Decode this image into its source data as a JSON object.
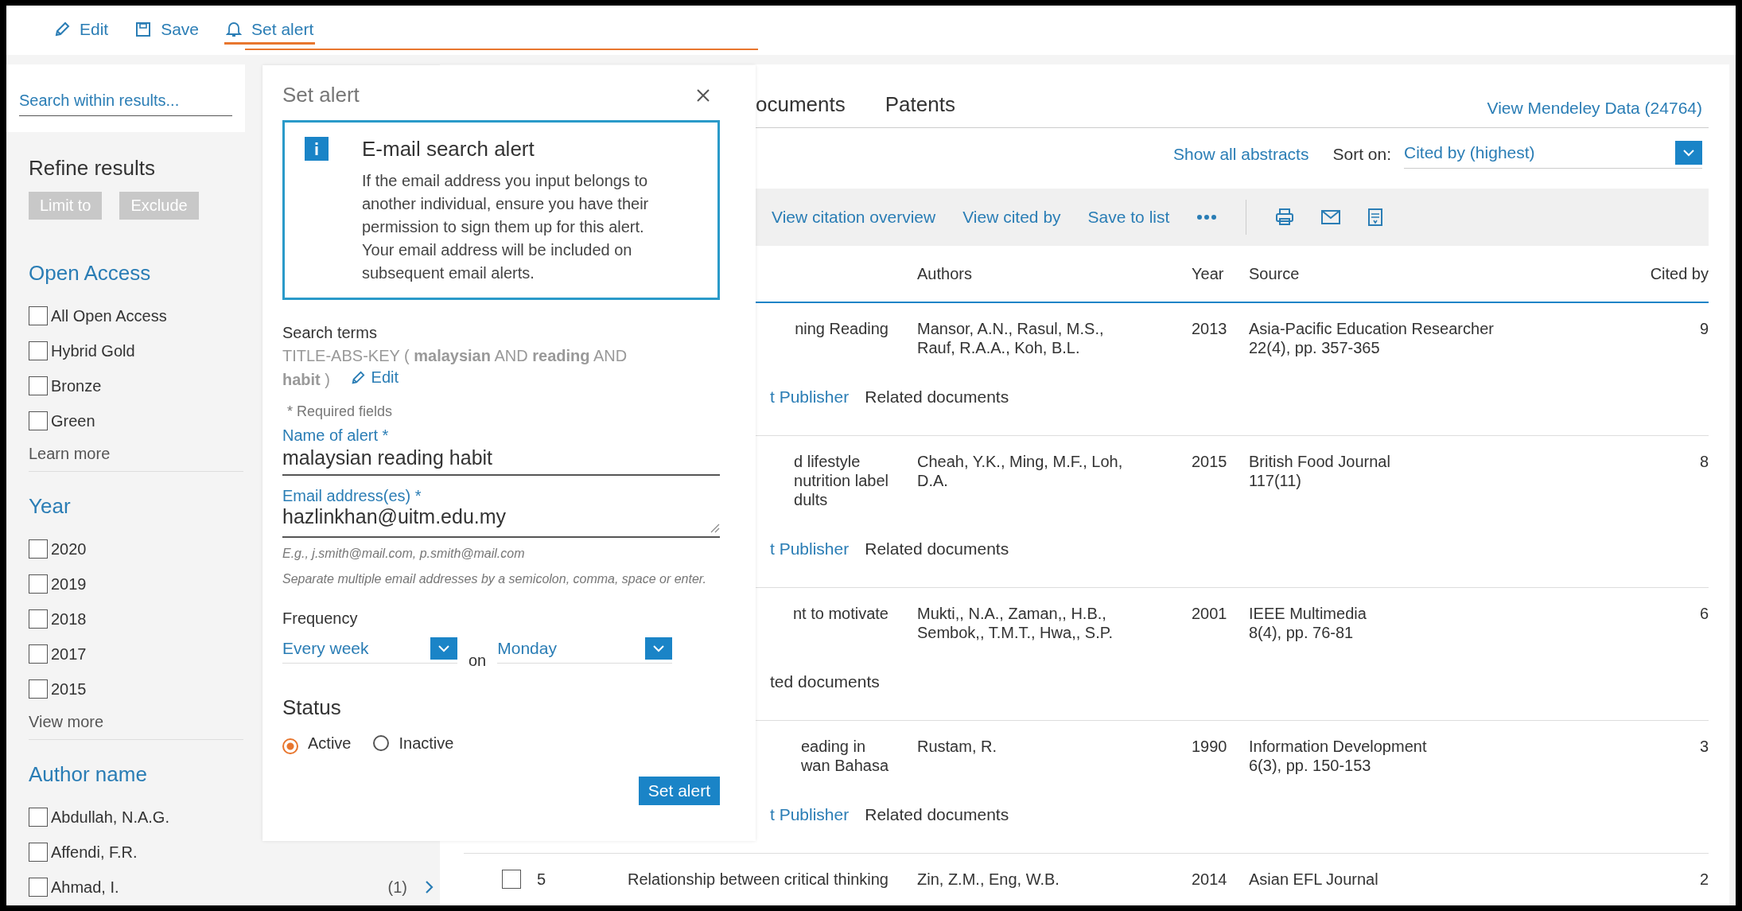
{
  "toolbar": {
    "items": [
      {
        "kind": "edit",
        "label": "Edit",
        "selected": false
      },
      {
        "kind": "save",
        "label": "Save",
        "selected": false
      },
      {
        "kind": "alert",
        "label": "Set alert",
        "selected": true
      }
    ]
  },
  "sidebar": {
    "search_placeholder": "Search within results...",
    "refine_title": "Refine results",
    "buttons": [
      {
        "label": "Limit to",
        "disabled": true
      },
      {
        "label": "Exclude",
        "disabled": true
      }
    ],
    "groups": [
      {
        "title": "Open Access",
        "items": [
          {
            "label": "All Open Access",
            "checked": false
          },
          {
            "label": "Hybrid Gold",
            "checked": false
          },
          {
            "label": "Bronze",
            "checked": false
          },
          {
            "label": "Green",
            "checked": false
          }
        ],
        "more": "Learn more"
      },
      {
        "title": "Year",
        "items": [
          {
            "label": "2020",
            "checked": false
          },
          {
            "label": "2019",
            "checked": false
          },
          {
            "label": "2018",
            "checked": false
          },
          {
            "label": "2017",
            "checked": false
          },
          {
            "label": "2015",
            "checked": false
          }
        ],
        "more": "View more"
      },
      {
        "title": "Author name",
        "items": [
          {
            "label": "Abdullah, N.A.G.",
            "checked": false
          },
          {
            "label": "Affendi, F.R.",
            "checked": false
          },
          {
            "label": "Ahmad, I.",
            "checked": false,
            "count": "(1)"
          }
        ]
      }
    ]
  },
  "results": {
    "tabs": [
      {
        "label": "ocuments",
        "selected": false
      },
      {
        "label": "Patents",
        "selected": false
      }
    ],
    "mendeley_link": "View Mendeley Data (24764)",
    "show_abstracts": "Show all abstracts",
    "sort_label": "Sort on:",
    "sort_value": "Cited by (highest)",
    "actions": [
      "View citation overview",
      "View cited by",
      "Save to list"
    ],
    "columns": [
      "Authors",
      "Year",
      "Source",
      "Cited by"
    ],
    "rows": [
      {
        "title_lines": [
          "ning Reading"
        ],
        "authors_lines": [
          "Mansor, A.N., Rasul, M.S.,",
          "Rauf, R.A.A., Koh, B.L."
        ],
        "year": "2013",
        "source_lines": [
          "Asia-Pacific Education Researcher",
          "22(4), pp. 357-365"
        ],
        "cited_by": "9",
        "links": [
          {
            "kind": "link",
            "label": "t Publisher"
          },
          {
            "kind": "plain",
            "label": "Related documents"
          }
        ]
      },
      {
        "title_lines": [
          "d lifestyle",
          "nutrition label",
          "dults"
        ],
        "authors_lines": [
          "Cheah, Y.K., Ming, M.F., Loh,",
          "D.A."
        ],
        "year": "2015",
        "source_lines": [
          "British Food Journal",
          "117(11)"
        ],
        "cited_by": "8",
        "links": [
          {
            "kind": "link",
            "label": "t Publisher"
          },
          {
            "kind": "plain",
            "label": "Related documents"
          }
        ]
      },
      {
        "title_lines": [
          "nt to motivate"
        ],
        "authors_lines": [
          "Mukti,, N.A., Zaman,, H.B.,",
          "Sembok,, T.M.T., Hwa,, S.P."
        ],
        "year": "2001",
        "source_lines": [
          "IEEE Multimedia",
          "8(4), pp. 76-81"
        ],
        "cited_by": "6",
        "links": [
          {
            "kind": "plain",
            "label": "ted documents"
          }
        ]
      },
      {
        "title_lines": [
          "eading in",
          "wan Bahasa"
        ],
        "authors_lines": [
          "Rustam, R."
        ],
        "year": "1990",
        "source_lines": [
          "Information Development",
          "6(3), pp. 150-153"
        ],
        "cited_by": "3",
        "links": [
          {
            "kind": "link",
            "label": "t Publisher"
          },
          {
            "kind": "plain",
            "label": "Related documents"
          }
        ]
      },
      {
        "checked": false,
        "number": "5",
        "title_lines": [
          "Relationship between critical thinking"
        ],
        "authors_lines": [
          "Zin, Z.M., Eng, W.B."
        ],
        "year": "2014",
        "source_lines": [
          "Asian EFL Journal"
        ],
        "cited_by": "2"
      }
    ]
  },
  "alert": {
    "title": "Set alert",
    "info_title": "E-mail search alert",
    "info_text": "If the email address you input belongs to another individual, ensure you have their permission to sign them up for this alert. Your email address will be included on subsequent email alerts.",
    "search_terms_label": "Search terms",
    "search_terms": "TITLE-ABS-KEY ( **malaysian** AND **reading** AND **habit** )",
    "edit_link": "Edit",
    "required_note": "* Required fields",
    "name_label": "Name of alert *",
    "name_value": "malaysian reading habit",
    "email_label": "Email address(es) *",
    "email_value": "hazlinkhan@uitm.edu.my",
    "email_hint": "E.g., j.smith@mail.com, p.smith@mail.com",
    "email_help": "Separate multiple email addresses by a semicolon, comma, space or enter.",
    "frequency_label": "Frequency",
    "frequency_value": "Every week",
    "on_label": "on",
    "day_value": "Monday",
    "status_label": "Status",
    "status_options": [
      {
        "label": "Active",
        "selected": true
      },
      {
        "label": "Inactive",
        "selected": false
      }
    ],
    "submit": "Set alert"
  }
}
